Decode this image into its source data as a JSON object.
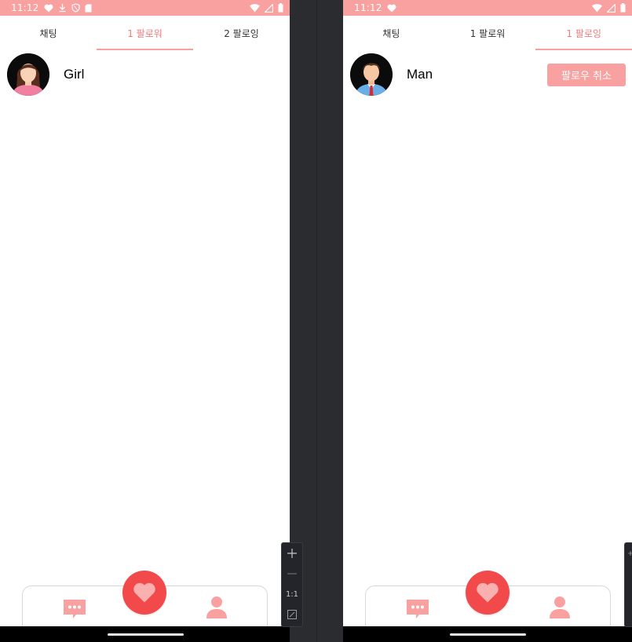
{
  "status_bar": {
    "time": "11:12"
  },
  "colors": {
    "accent": "#f9a1a1",
    "accent_text": "#f27a7a",
    "heart": "#f24a4a"
  },
  "left_screen": {
    "tabs": [
      {
        "label": "채팅"
      },
      {
        "label": "1 팔로워"
      },
      {
        "label": "2 팔로잉"
      }
    ],
    "active_tab": "1 팔로워",
    "list": [
      {
        "name": "Girl",
        "avatar": "girl-avatar"
      }
    ]
  },
  "right_screen": {
    "tabs": [
      {
        "label": "채팅"
      },
      {
        "label": "1 팔로워"
      },
      {
        "label": "1 팔로잉"
      }
    ],
    "active_tab": "1 팔로잉",
    "list": [
      {
        "name": "Man",
        "avatar": "man-avatar",
        "action_label": "팔로우 취소"
      }
    ]
  },
  "bottom_nav": {
    "left_icon": "chat-bubble-icon",
    "center_icon": "heart-icon",
    "right_icon": "person-icon"
  },
  "zoom_controls": {
    "zoom_label": "1:1"
  }
}
